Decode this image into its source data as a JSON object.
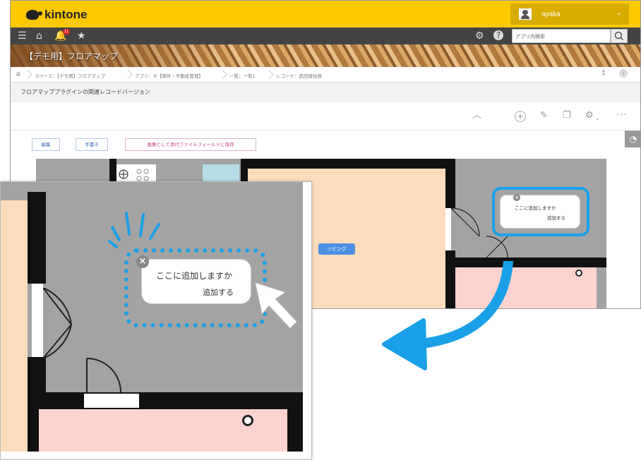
{
  "header": {
    "logo_text": "kintone",
    "user_name": "ayaka",
    "notification_count": "11"
  },
  "nav": {
    "search_placeholder": "アプリ内検索"
  },
  "app": {
    "title": "【デモ用】フロアマップ"
  },
  "breadcrumb": {
    "space": "スペース：【デモ用】フロアマップ",
    "app": "アプリ：⑥【物件・不動産管理】",
    "view": "一覧：一覧1",
    "record": "レコード：武田様住居"
  },
  "page": {
    "subtitle": "フロアマッププラグインの関連レコードバージョン"
  },
  "buttons": {
    "edit": "編集",
    "handwriting": "手書き",
    "save_image": "画像として添付ファイルフィールドに保存"
  },
  "floorplan": {
    "room_tag": "リビング",
    "popup_question": "ここに追加しますか",
    "popup_action": "追加する"
  },
  "inset": {
    "popup_question": "ここに追加しますか",
    "popup_action": "追加する"
  },
  "colors": {
    "brand": "#fcc800",
    "accent": "#1aa0e8",
    "living_tag": "#4b8fe2"
  }
}
